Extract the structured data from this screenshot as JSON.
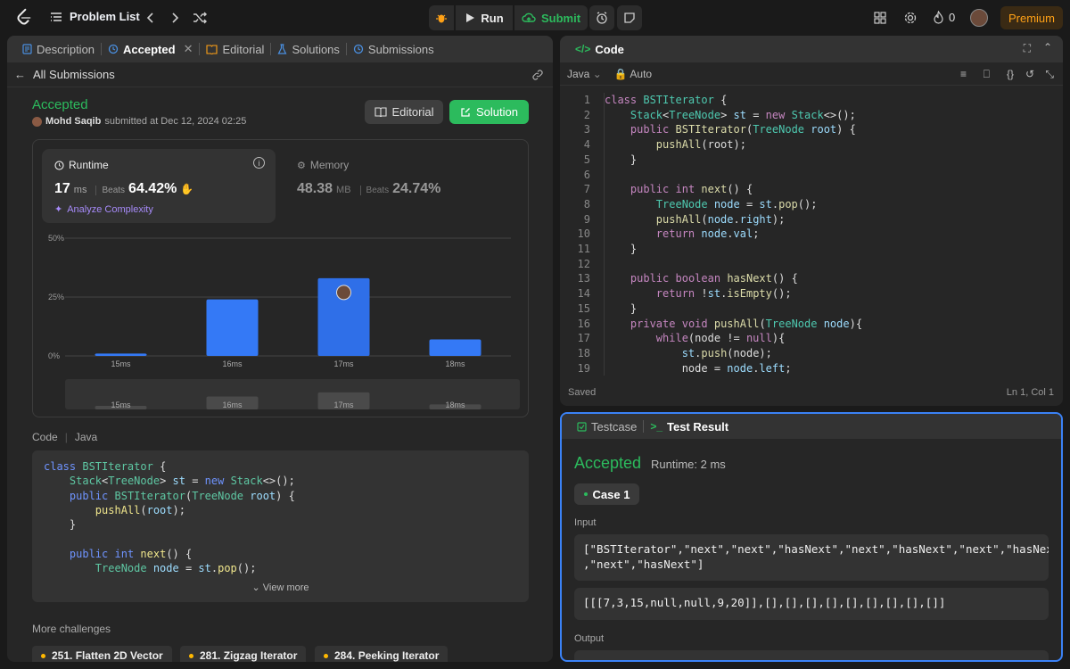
{
  "topbar": {
    "problem_list": "Problem List",
    "run_label": "Run",
    "submit_label": "Submit",
    "streak_count": "0",
    "premium_label": "Premium"
  },
  "left_tabs": [
    {
      "label": "Description"
    },
    {
      "label": "Accepted"
    },
    {
      "label": "Editorial"
    },
    {
      "label": "Solutions"
    },
    {
      "label": "Submissions"
    }
  ],
  "submission": {
    "back_label": "All Submissions",
    "status": "Accepted",
    "user": "Mohd Saqib",
    "submitted_text": "submitted at Dec 12, 2024 02:25",
    "editorial_btn": "Editorial",
    "solution_btn": "Solution"
  },
  "runtime": {
    "title": "Runtime",
    "value": "17",
    "unit": "ms",
    "beats_label": "Beats",
    "beats_value": "64.42%",
    "analyze": "Analyze Complexity"
  },
  "memory": {
    "title": "Memory",
    "value": "48.38",
    "unit": "MB",
    "beats_label": "Beats",
    "beats_value": "24.74%"
  },
  "chart_data": {
    "type": "bar",
    "categories": [
      "15ms",
      "16ms",
      "17ms",
      "18ms"
    ],
    "values": [
      1,
      24,
      33,
      7
    ],
    "ylim": [
      0,
      50
    ],
    "yticks": [
      "0%",
      "25%",
      "50%"
    ],
    "highlight_index": 2,
    "grid": true,
    "overview_categories": [
      "15ms",
      "16ms",
      "17ms",
      "18ms"
    ]
  },
  "code_section": {
    "label": "Code",
    "lang": "Java",
    "view_more": "View more"
  },
  "more_challenges": {
    "title": "More challenges",
    "items": [
      "251. Flatten 2D Vector",
      "281. Zigzag Iterator",
      "284. Peeking Iterator"
    ]
  },
  "editor": {
    "title": "Code",
    "language": "Java",
    "mode": "Auto",
    "saved": "Saved",
    "position": "Ln 1, Col 1",
    "line_numbers": "1\n2\n3\n4\n5\n6\n7\n8\n9\n10\n11\n12\n13\n14\n15\n16\n17\n18\n19"
  },
  "result": {
    "tab_testcase": "Testcase",
    "tab_result": "Test Result",
    "status": "Accepted",
    "runtime": "Runtime: 2 ms",
    "case_label": "Case 1",
    "input_label": "Input",
    "input_line1": "[\"BSTIterator\",\"next\",\"next\",\"hasNext\",\"next\",\"hasNext\",\"next\",\"hasNext\"\n,\"next\",\"hasNext\"]",
    "input_line2": "[[[7,3,15,null,null,9,20]],[],[],[],[],[],[],[],[],[]]",
    "output_label": "Output"
  }
}
